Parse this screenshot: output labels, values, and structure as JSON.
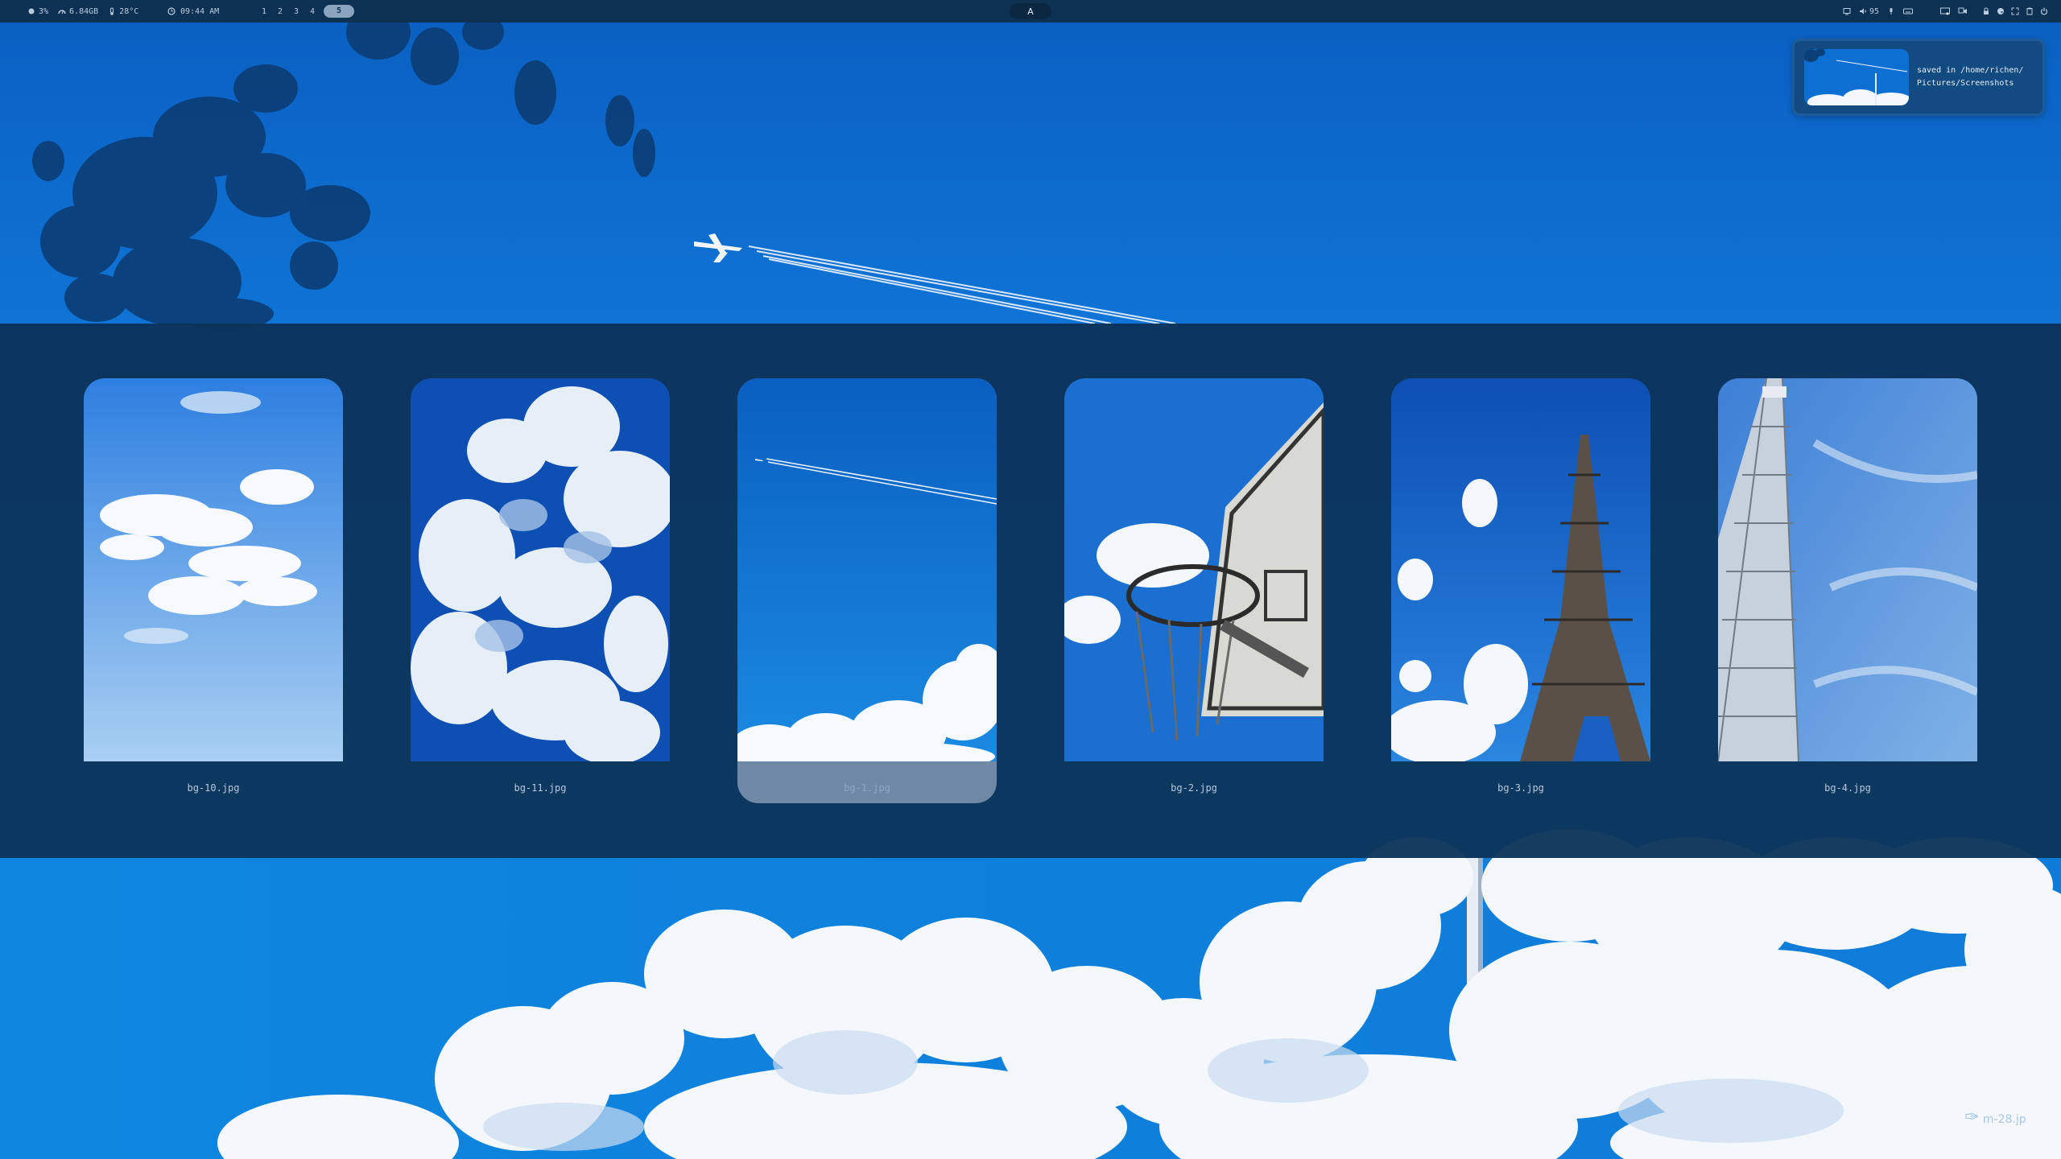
{
  "topbar": {
    "cpu": "3%",
    "memory": "6.84GB",
    "temperature": "28°C",
    "clock": "09:44 AM",
    "workspaces": [
      "1",
      "2",
      "3",
      "4",
      "5"
    ],
    "active_workspace": "5",
    "center_glyph": "A",
    "volume": "95"
  },
  "notification": {
    "line1": "saved in /home/richen/",
    "line2": "Pictures/Screenshots"
  },
  "wallpapers": [
    {
      "label": "bg-10.jpg",
      "selected": false,
      "thumb": "clouds-light"
    },
    {
      "label": "bg-11.jpg",
      "selected": false,
      "thumb": "clouds-dense"
    },
    {
      "label": "bg-1.jpg",
      "selected": true,
      "thumb": "plane-contrail"
    },
    {
      "label": "bg-2.jpg",
      "selected": false,
      "thumb": "basketball-hoop"
    },
    {
      "label": "bg-3.jpg",
      "selected": false,
      "thumb": "eiffel-tower"
    },
    {
      "label": "bg-4.jpg",
      "selected": false,
      "thumb": "tokyo-skytree"
    }
  ],
  "watermark": "m-28.jp",
  "colors": {
    "bar": "#0d3152",
    "panel": "#0d345a",
    "selected": "#6f88a6",
    "sky": "#0d6fd3"
  }
}
